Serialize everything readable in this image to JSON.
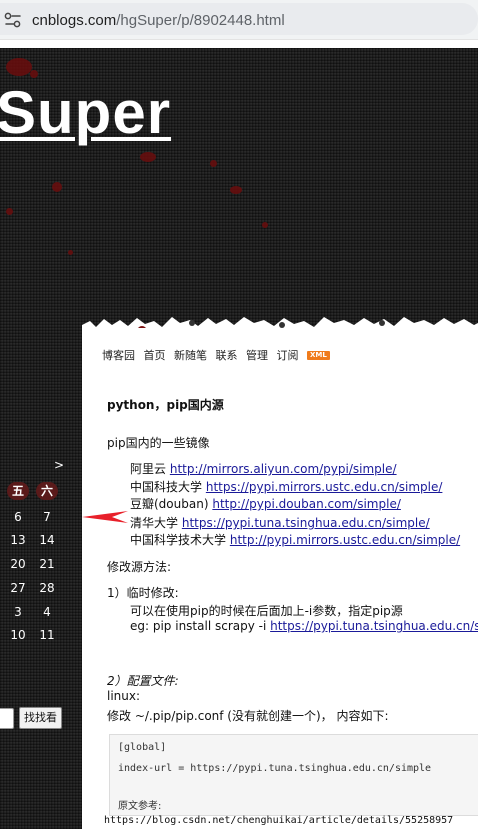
{
  "browser": {
    "url_host": "cnblogs.com",
    "url_path": "/hgSuper/p/8902448.html"
  },
  "blog": {
    "title": "Super"
  },
  "calendar": {
    "next": ">",
    "headers": [
      "五",
      "六"
    ],
    "rows": [
      [
        "6",
        "7"
      ],
      [
        "13",
        "14"
      ],
      [
        "20",
        "21"
      ],
      [
        "27",
        "28"
      ],
      [
        "3",
        "4"
      ],
      [
        "10",
        "11"
      ]
    ]
  },
  "sidebar": {
    "search_button": "找找看"
  },
  "nav": {
    "items": [
      "博客园",
      "首页",
      "新随笔",
      "联系",
      "管理",
      "订阅"
    ],
    "xml_badge": "XML"
  },
  "post": {
    "title": "python，pip国内源",
    "intro": "pip国内的一些镜像",
    "mirrors": [
      {
        "name": "阿里云",
        "url": "http://mirrors.aliyun.com/pypi/simple/"
      },
      {
        "name": "中国科技大学",
        "url": "https://pypi.mirrors.ustc.edu.cn/simple/"
      },
      {
        "name": "豆瓣(douban)",
        "url": "http://pypi.douban.com/simple/"
      },
      {
        "name": "清华大学",
        "url": "https://pypi.tuna.tsinghua.edu.cn/simple/"
      },
      {
        "name": "中国科学技术大学",
        "url": "http://pypi.mirrors.ustc.edu.cn/simple/"
      }
    ],
    "method_heading": "修改源方法:",
    "temp_heading": "1）临时修改:",
    "temp_desc": "可以在使用pip的时候在后面加上-i参数，指定pip源",
    "temp_example_prefix": "eg: pip install scrapy -i ",
    "temp_example_url": "https://pypi.tuna.tsinghua.edu.cn/simple",
    "config_heading": "2）配置文件:",
    "linux_label": "linux:",
    "config_desc": "修改 ~/.pip/pip.conf (没有就创建一个)， 内容如下:",
    "code_line1": "[global]",
    "code_line2": "index-url = https://pypi.tuna.tsinghua.edu.cn/simple",
    "ref_label": "原文参考:",
    "ref_url": "https://blog.csdn.net/chenghuikai/article/details/55258957"
  },
  "colors": {
    "accent_arrow": "#e8202a",
    "link": "#1a1a99",
    "xml_badge": "#f07b1b",
    "splatter": "#6a0d0d"
  }
}
